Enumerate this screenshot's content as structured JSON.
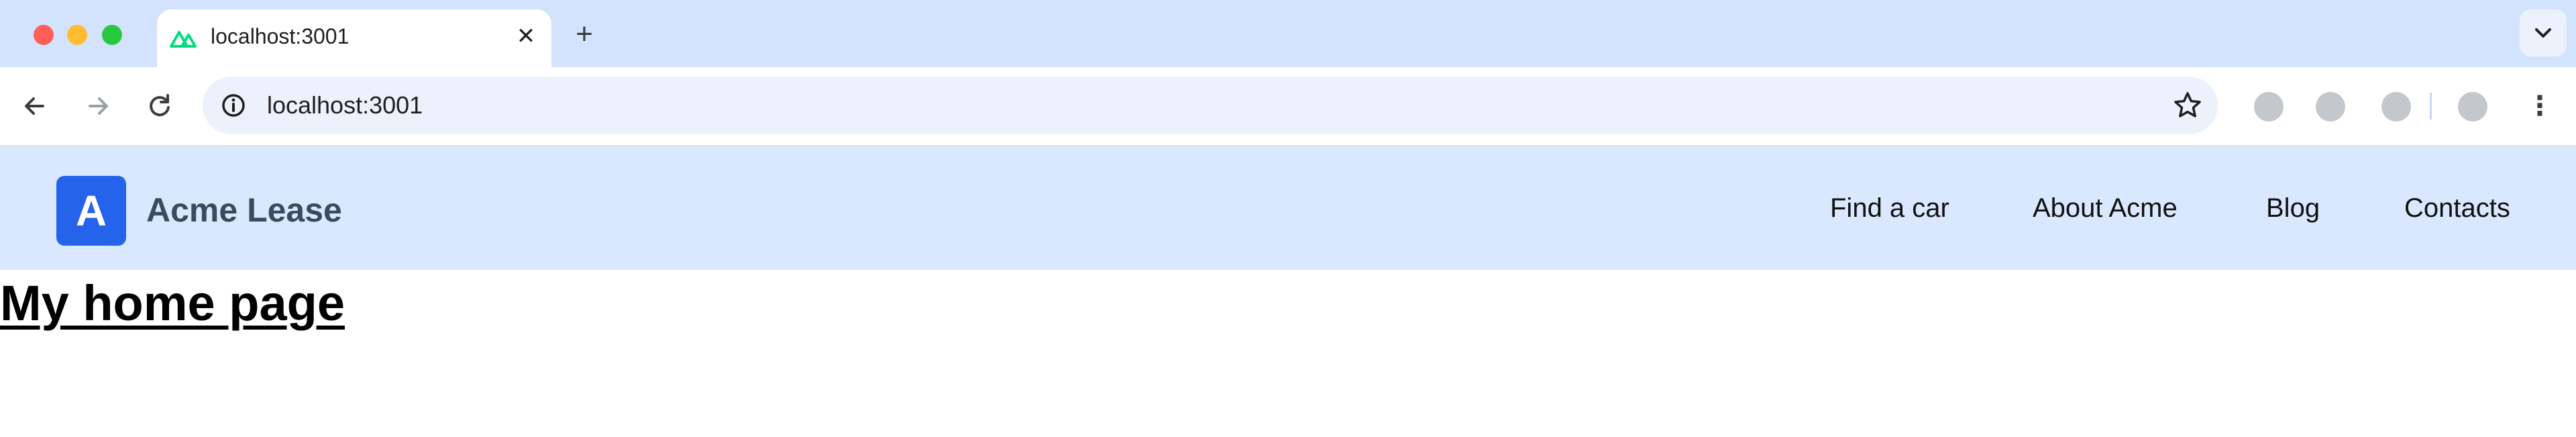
{
  "browser": {
    "tab": {
      "title": "localhost:3001",
      "favicon": "nuxt-logo-icon",
      "close_glyph": "✕"
    },
    "new_tab_glyph": "+",
    "address": {
      "url": "localhost:3001"
    },
    "menu_glyph": "⋮"
  },
  "site": {
    "logo_letter": "A",
    "brand": "Acme Lease",
    "nav": [
      {
        "label": "Find a car"
      },
      {
        "label": "About Acme"
      },
      {
        "label": "Blog"
      },
      {
        "label": "Contacts"
      }
    ]
  },
  "page": {
    "heading": "My home page"
  },
  "colors": {
    "tabstrip": "#d3e3fd",
    "header_bg": "#d9e8ff",
    "logo_bg": "#2563eb",
    "brand_text": "#3c4a5e",
    "favicon": "#00dc82"
  }
}
